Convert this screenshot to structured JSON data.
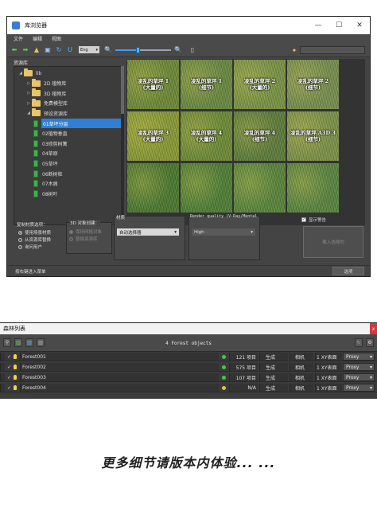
{
  "library": {
    "title": "库浏览器",
    "window_controls": [
      "—",
      "☐",
      "✕"
    ],
    "menu": [
      "文件",
      "编辑",
      "视图"
    ],
    "toolbar": {
      "format_select": "Eng"
    },
    "tree_label": "资源库",
    "tree": [
      {
        "label": "lib",
        "kind": "folder",
        "expanded": true,
        "level": 0
      },
      {
        "label": "2D 植物库",
        "kind": "folder",
        "expanded": false,
        "level": 1
      },
      {
        "label": "3D 植物库",
        "kind": "folder",
        "expanded": false,
        "level": 1
      },
      {
        "label": "免费模型库",
        "kind": "folder",
        "expanded": false,
        "level": 1
      },
      {
        "label": "预设资源库",
        "kind": "folder",
        "expanded": true,
        "level": 1
      },
      {
        "label": "01草坪分层",
        "kind": "book",
        "selected": true,
        "level": 2
      },
      {
        "label": "02植物垂直",
        "kind": "book",
        "level": 2
      },
      {
        "label": "03修剪树篱",
        "kind": "book",
        "level": 2
      },
      {
        "label": "04草原",
        "kind": "book",
        "level": 2
      },
      {
        "label": "05草坪",
        "kind": "book",
        "level": 2
      },
      {
        "label": "06断树桩",
        "kind": "book",
        "level": 2
      },
      {
        "label": "07木屑",
        "kind": "book",
        "level": 2
      },
      {
        "label": "08树叶",
        "kind": "book",
        "level": 2
      }
    ],
    "tiles": [
      {
        "line1": "凌乱的草坪 1",
        "line2": "(大量的)",
        "color": "#6f8a3c"
      },
      {
        "line1": "凌乱的草坪 1",
        "line2": "(细节)",
        "color": "#6b8a45"
      },
      {
        "line1": "凌乱的草坪 2",
        "line2": "(大量的)",
        "color": "#7b9449"
      },
      {
        "line1": "凌乱的草坪 2",
        "line2": "(细节)",
        "color": "#788f52"
      },
      {
        "line1": "凌乱的草坪 3",
        "line2": "(大量的)",
        "color": "#8a9a3a"
      },
      {
        "line1": "凌乱的草坪 4",
        "line2": "(大量的)",
        "color": "#6f8c3b"
      },
      {
        "line1": "凌乱的草坪 4",
        "line2": "(细节)",
        "color": "#5f7e3f"
      },
      {
        "line1": "凌乱的草坪 A3D 3",
        "line2": "(细节)",
        "color": "#7e934c"
      },
      {
        "line1": "",
        "line2": "",
        "color": "#4e7a34"
      },
      {
        "line1": "",
        "line2": "",
        "color": "#51803a"
      },
      {
        "line1": "",
        "line2": "",
        "color": "#5b8640"
      },
      {
        "line1": "",
        "line2": "",
        "color": "#5c8544"
      }
    ],
    "material_group_label": "复制材质选项：",
    "material_options": [
      {
        "label": "使用场景材质",
        "selected": true
      },
      {
        "label": "从资源库替换",
        "selected": false
      },
      {
        "label": "询问用户",
        "selected": false
      }
    ],
    "create_group_label": "3D 对象创建：",
    "create_options": [
      {
        "label": "保持网格对象",
        "selected": true
      },
      {
        "label": "替换资源库",
        "selected": false
      }
    ],
    "material_label": "材质",
    "material_dropdown": "自动选择器",
    "render_quality_label": "Render quality (V-Ray/Mental",
    "render_quality_dropdown": "High",
    "show_warning_label": "显示警告",
    "show_warning_checked": true,
    "load_button": "载入选择的",
    "status_hint": "按右键进入菜单",
    "options_button": "选项"
  },
  "forest": {
    "title": "森林列表",
    "close_glyph": "x",
    "header": "4 Forest objects",
    "rows": [
      {
        "name": "Forest001",
        "status_color": "#4dc24d",
        "count": "121 项目",
        "mode": "生成",
        "camera": "相机",
        "map": "1 XY表面",
        "display": "Proxy"
      },
      {
        "name": "Forest002",
        "status_color": "#4dc24d",
        "count": "575 项目",
        "mode": "生成",
        "camera": "相机",
        "map": "1 XY表面",
        "display": "Proxy"
      },
      {
        "name": "Forest003",
        "status_color": "#4dc24d",
        "count": "107 项目",
        "mode": "生成",
        "camera": "相机",
        "map": "1 XY表面",
        "display": "Proxy"
      },
      {
        "name": "Forest004",
        "status_color": "#e6c33a",
        "count": "N/A",
        "mode": "生成",
        "camera": "相机",
        "map": "1 XY表面",
        "display": "Proxy"
      }
    ]
  },
  "footer": "更多细节请版本内体验... ..."
}
